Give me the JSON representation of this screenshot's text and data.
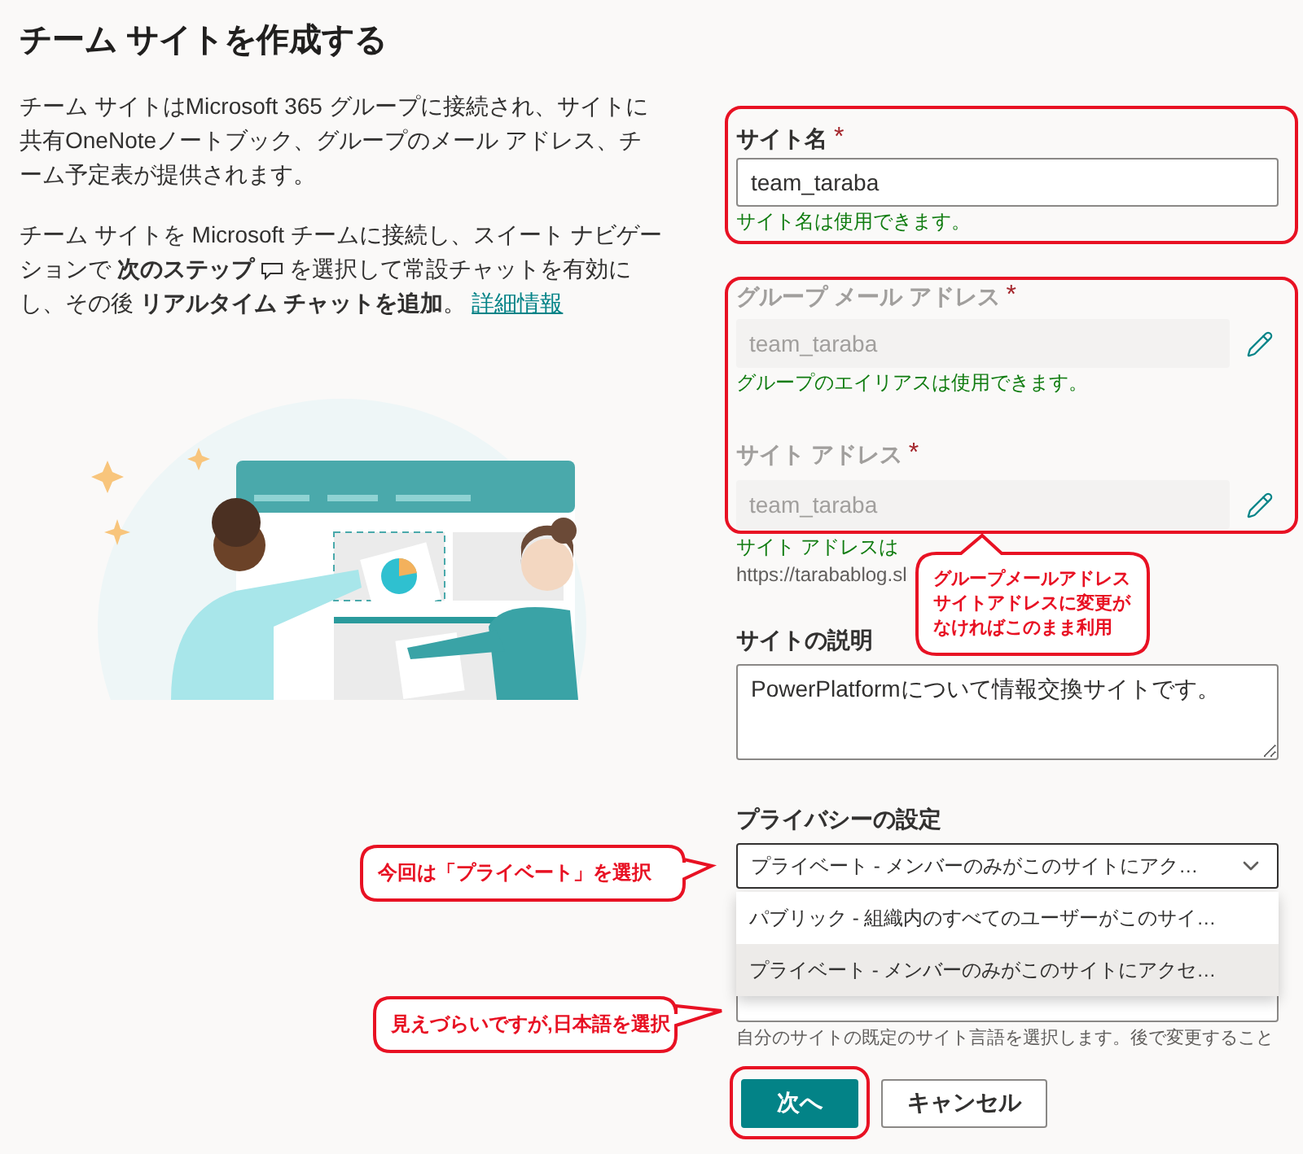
{
  "title": "チーム サイトを作成する",
  "intro": {
    "paragraph": "チーム サイトはMicrosoft 365 グループに接続され、サイトに共有OneNoteノートブック、グループのメール アドレス、チーム予定表が提供されます。",
    "before_icon": "チーム サイトを Microsoft チームに接続し、スイート ナビゲーションで **次のステップ**",
    "after_icon": "を選択して常設チャットを有効にし、その後 **リアルタイム チャットを追加**。",
    "link": "詳細情報"
  },
  "site_name": {
    "label": "サイト名",
    "required_mark": "*",
    "value": "team_taraba",
    "message": "サイト名は使用できます。",
    "highlighted": true
  },
  "address_group": {
    "highlighted": true,
    "fields": [
      {
        "label": "グループ メール アドレス",
        "required_mark": "*",
        "disabled": true,
        "value": "team_taraba",
        "message": "グループのエイリアスは使用できます。"
      },
      {
        "label": "サイト アドレス",
        "required_mark": "*",
        "disabled": true,
        "value": "team_taraba"
      }
    ]
  },
  "site_address_message": "サイト アドレスは",
  "site_url": "https://tarabablog.sl",
  "description": {
    "label": "サイトの説明",
    "value": "PowerPlatformについて情報交換サイトです。"
  },
  "privacy": {
    "label": "プライバシーの設定",
    "value": "プライベート - メンバーのみがこのサイトにアク…",
    "expanded": true,
    "options": [
      {
        "label": "パブリック - 組織内のすべてのユーザーがこのサイ…",
        "selected": false
      },
      {
        "label": "プライベート - メンバーのみがこのサイトにアクセ…",
        "selected": true
      }
    ]
  },
  "language": {
    "hint": "自分のサイトの既定のサイト言語を選択します。後で変更すること"
  },
  "buttons": [
    {
      "label": "次へ",
      "kind": "primary",
      "highlighted": true
    },
    {
      "label": "キャンセル",
      "kind": "secondary",
      "highlighted": false
    }
  ],
  "annotations": [
    {
      "lines": [
        "グループメールアドレス",
        "サイトアドレスに変更が",
        "なければこのまま利用"
      ]
    },
    {
      "lines": [
        "今回は「プライベート」を選択"
      ]
    },
    {
      "lines": [
        "見えづらいですが,日本語を選択"
      ]
    }
  ]
}
